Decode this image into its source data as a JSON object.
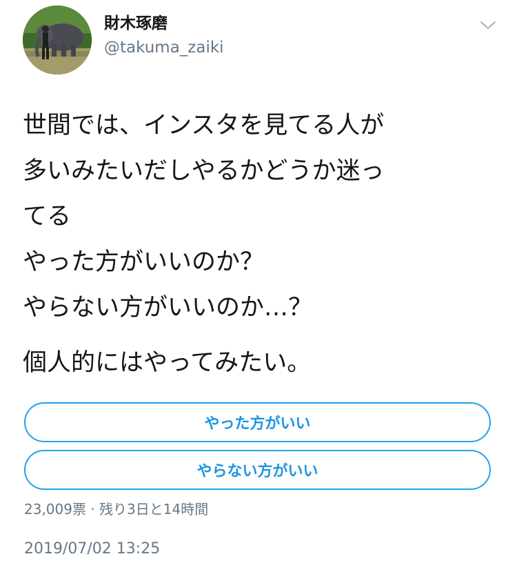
{
  "user": {
    "display_name": "財木琢磨",
    "handle": "@takuma_zaiki",
    "avatar_icon": "profile-photo-elephant"
  },
  "tweet": {
    "lines": [
      "世間では、インスタを見てる人が",
      "多いみたいだしやるかどうか迷っ",
      "てる",
      "やった方がいいのか？",
      "やらない方がいいのか…？"
    ],
    "closing_line": "個人的にはやってみたい。"
  },
  "poll": {
    "options": [
      "やった方がいい",
      "やらない方がいい"
    ],
    "votes": "23,009票",
    "separator": " · ",
    "time_left": "残り3日と14時間"
  },
  "timestamp": "2019/07/02 13:25",
  "colors": {
    "accent": "#1da1f2",
    "poll_text": "#1b95e0",
    "secondary_text": "#657786"
  }
}
